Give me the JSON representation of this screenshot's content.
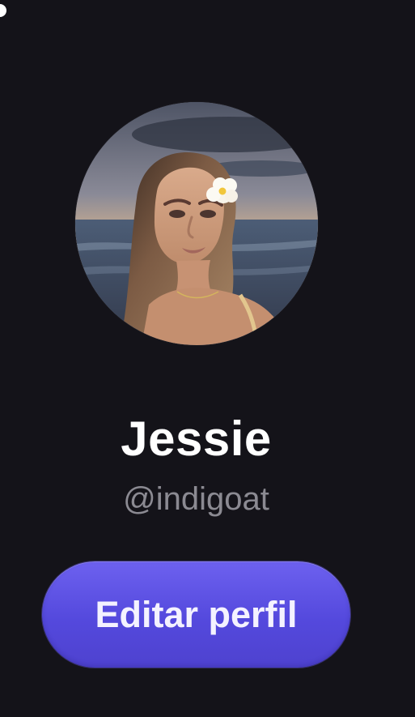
{
  "profile": {
    "display_name": "Jessie",
    "username": "@indigoat",
    "avatar_alt": "Profile photo"
  },
  "actions": {
    "edit_profile_label": "Editar perfil"
  },
  "theme": {
    "background": "#141319",
    "primary": "#5B50E8",
    "name_text": "#FFFFFF",
    "handle_text": "#8B8A92"
  }
}
